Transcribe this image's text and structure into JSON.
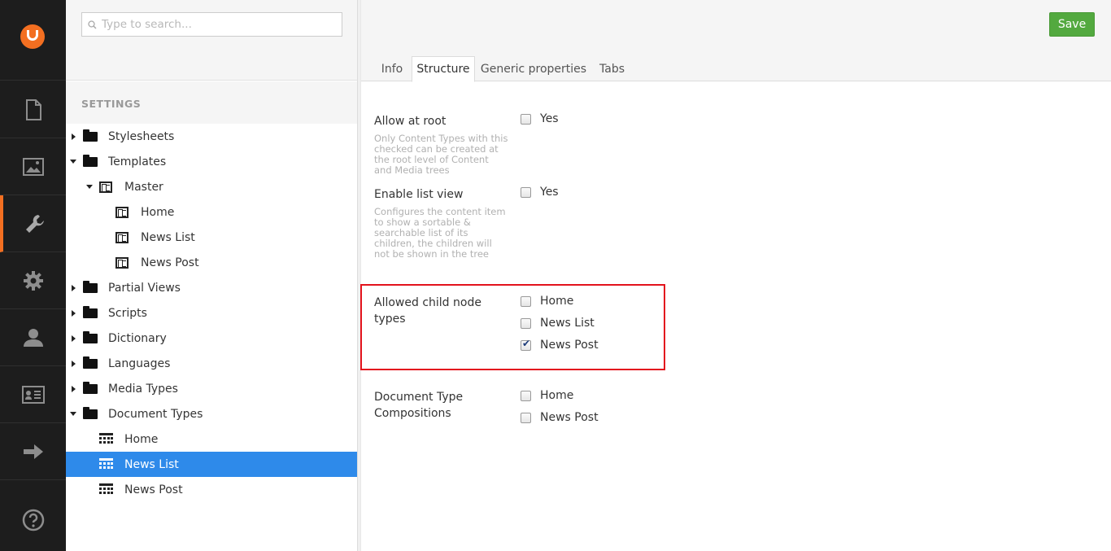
{
  "colors": {
    "rail": "#1d1d1d",
    "accent": "#f36f21",
    "selected": "#2e8aea",
    "save": "#53a93f",
    "highlight": "#e3131d"
  },
  "rail": {
    "items": [
      {
        "name": "content",
        "icon": "document-icon"
      },
      {
        "name": "media",
        "icon": "image-icon"
      },
      {
        "name": "settings",
        "icon": "wrench-icon",
        "active": true
      },
      {
        "name": "developer",
        "icon": "gear-icon"
      },
      {
        "name": "users",
        "icon": "user-icon"
      },
      {
        "name": "members",
        "icon": "id-card-icon"
      },
      {
        "name": "forms",
        "icon": "arrow-right-icon"
      }
    ],
    "help_icon": "help-icon"
  },
  "tree": {
    "search_placeholder": "Type to search...",
    "section": "SETTINGS",
    "items": [
      {
        "label": "Stylesheets",
        "expanded": false
      },
      {
        "label": "Templates",
        "expanded": true
      },
      {
        "label": "Master",
        "expanded": true
      },
      {
        "label": "Home"
      },
      {
        "label": "News List"
      },
      {
        "label": "News Post"
      },
      {
        "label": "Partial Views",
        "expanded": false
      },
      {
        "label": "Scripts",
        "expanded": false
      },
      {
        "label": "Dictionary",
        "expanded": false
      },
      {
        "label": "Languages",
        "expanded": false
      },
      {
        "label": "Media Types",
        "expanded": false
      },
      {
        "label": "Document Types",
        "expanded": true
      },
      {
        "label": "Home"
      },
      {
        "label": "News List",
        "selected": true
      },
      {
        "label": "News Post"
      }
    ]
  },
  "editor": {
    "save_label": "Save",
    "tabs": [
      {
        "label": "Info"
      },
      {
        "label": "Structure",
        "active": true
      },
      {
        "label": "Generic properties"
      },
      {
        "label": "Tabs"
      }
    ],
    "properties": [
      {
        "label": "Allow at root",
        "description": [
          "Only Content Types with this",
          "checked can be created at",
          "the root level of Content",
          "and Media trees"
        ],
        "options": [
          {
            "label": "Yes",
            "checked": false
          }
        ]
      },
      {
        "label": "Enable list view",
        "description": [
          "Configures the content item",
          "to show a sortable &",
          "searchable list of its",
          "children, the children will",
          "not be shown in the tree"
        ],
        "options": [
          {
            "label": "Yes",
            "checked": false
          }
        ]
      },
      {
        "label_lines": [
          "Allowed child node",
          "types"
        ],
        "options": [
          {
            "label": "Home",
            "checked": false
          },
          {
            "label": "News List",
            "checked": false
          },
          {
            "label": "News Post",
            "checked": true
          }
        ]
      },
      {
        "label_lines": [
          "Document Type",
          "Compositions"
        ],
        "options": [
          {
            "label": "Home",
            "checked": false
          },
          {
            "label": "News Post",
            "checked": false
          }
        ]
      }
    ]
  }
}
